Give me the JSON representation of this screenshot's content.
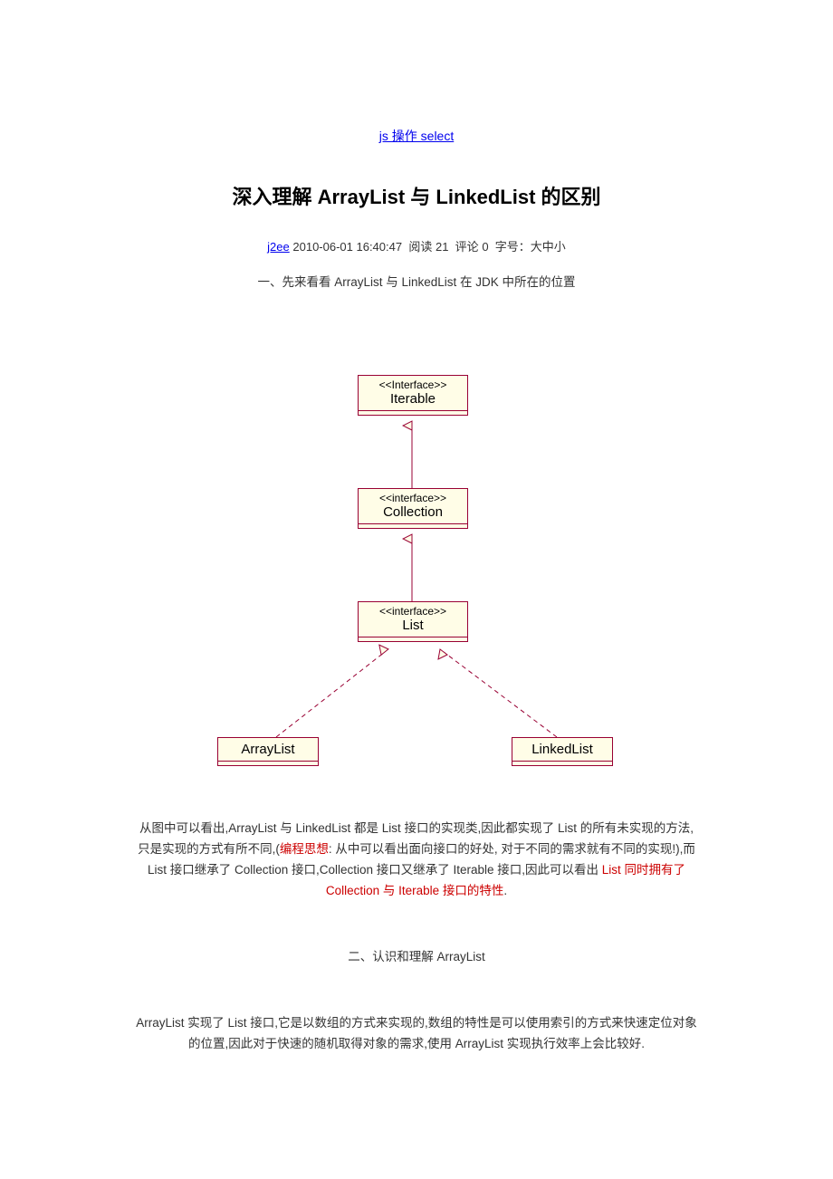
{
  "top_link": "js 操作 select",
  "title": "深入理解 ArrayList 与 LinkedList 的区别",
  "meta": {
    "category": "j2ee",
    "datetime": "2010-06-01 16:40:47",
    "reads_label": "阅读",
    "reads": "21",
    "comments_label": "评论",
    "comments": "0",
    "font_label": "字号：",
    "font_options": "大中小"
  },
  "section1_heading": "一、先来看看 ArrayList 与 LinkedList  在 JDK 中所在的位置",
  "uml": {
    "iterable_st": "<<Interface>>",
    "iterable_nm": "Iterable",
    "collection_st": "<<interface>>",
    "collection_nm": "Collection",
    "list_st": "<<interface>>",
    "list_nm": "List",
    "arraylist_nm": "ArrayList",
    "linkedlist_nm": "LinkedList"
  },
  "para1_a": "从图中可以看出,ArrayList 与 LinkedList 都是 List 接口的实现类,因此都实现了 List 的所有未实现的方法,只是实现的方式有所不同,(",
  "para1_red1": "编程思想",
  "para1_b": ":  从中可以看出面向接口的好处,  对于不同的需求就有不同的实现!),而 List 接口继承了 Collection 接口,Collection 接口又继承了 Iterable 接口,因此可以看出 ",
  "para1_red2": "List 同时拥有了 Collection 与 Iterable 接口的特性",
  "para1_c": ".",
  "section2_heading": "二、认识和理解 ArrayList",
  "para2": "ArrayList 实现了 List 接口,它是以数组的方式来实现的,数组的特性是可以使用索引的方式来快速定位对象的位置,因此对于快速的随机取得对象的需求,使用 ArrayList 实现执行效率上会比较好."
}
